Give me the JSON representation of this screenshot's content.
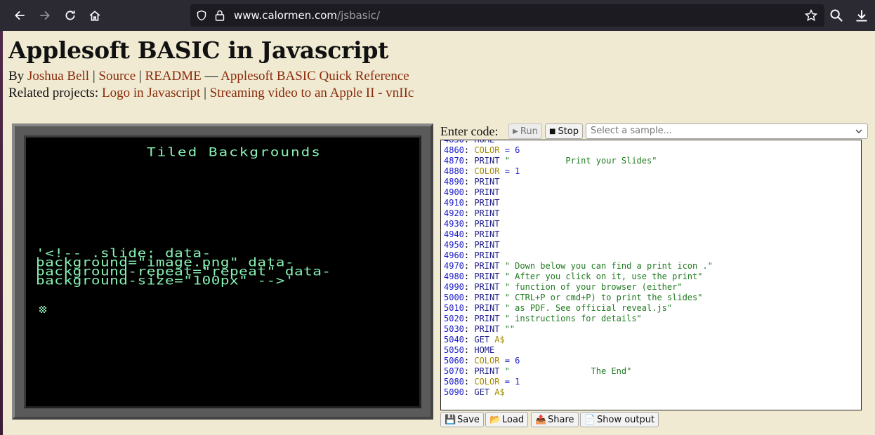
{
  "browser": {
    "url_domain": "www.calormen.com",
    "url_path": "/jsbasic/"
  },
  "page": {
    "title": "Applesoft BASIC in Javascript",
    "byline_prefix": "By",
    "author_link": "Joshua Bell",
    "source_link": "Source",
    "readme_link": "README",
    "dash": "—",
    "quickref_link": "Applesoft BASIC Quick Reference",
    "related_prefix": "Related projects:",
    "logo_link": "Logo in Javascript",
    "streaming_link": "Streaming video to an Apple II - vnIIc"
  },
  "screen": {
    "title_line": "Tiled Backgrounds",
    "body_text": "'<!-- .slide: data-\nbackground=\"image.png\" data-\nbackground-repeat=\"repeat\" data-\nbackground-size=\"100px\" -->'"
  },
  "editor": {
    "label": "Enter code:",
    "run_label": "Run",
    "stop_label": "Stop",
    "sample_placeholder": "Select a sample...",
    "lines": [
      {
        "n": "4860",
        "kw": "COLOR",
        "rest": " = 6",
        "type": "color"
      },
      {
        "n": "4870",
        "kw": "PRINT",
        "rest": " \"           Print your Slides\"",
        "type": "print"
      },
      {
        "n": "4880",
        "kw": "COLOR",
        "rest": " = 1",
        "type": "color"
      },
      {
        "n": "4890",
        "kw": "PRINT",
        "rest": "",
        "type": "print"
      },
      {
        "n": "4900",
        "kw": "PRINT",
        "rest": "",
        "type": "print"
      },
      {
        "n": "4910",
        "kw": "PRINT",
        "rest": "",
        "type": "print"
      },
      {
        "n": "4920",
        "kw": "PRINT",
        "rest": "",
        "type": "print"
      },
      {
        "n": "4930",
        "kw": "PRINT",
        "rest": "",
        "type": "print"
      },
      {
        "n": "4940",
        "kw": "PRINT",
        "rest": "",
        "type": "print"
      },
      {
        "n": "4950",
        "kw": "PRINT",
        "rest": "",
        "type": "print"
      },
      {
        "n": "4960",
        "kw": "PRINT",
        "rest": "",
        "type": "print"
      },
      {
        "n": "4970",
        "kw": "PRINT",
        "rest": " \" Down below you can find a print icon .\"",
        "type": "print"
      },
      {
        "n": "4980",
        "kw": "PRINT",
        "rest": " \" After you click on it, use the print\"",
        "type": "print"
      },
      {
        "n": "4990",
        "kw": "PRINT",
        "rest": " \" function of your browser (either\"",
        "type": "print"
      },
      {
        "n": "5000",
        "kw": "PRINT",
        "rest": " \" CTRL+P or cmd+P) to print the slides\"",
        "type": "print"
      },
      {
        "n": "5010",
        "kw": "PRINT",
        "rest": " \" as PDF. See official reveal.js\"",
        "type": "print"
      },
      {
        "n": "5020",
        "kw": "PRINT",
        "rest": " \" instructions for details\"",
        "type": "print"
      },
      {
        "n": "5030",
        "kw": "PRINT",
        "rest": " \"\"",
        "type": "print"
      },
      {
        "n": "5040",
        "kw": "GET",
        "rest": " A$",
        "type": "get"
      },
      {
        "n": "5050",
        "kw": "HOME",
        "rest": "",
        "type": "home"
      },
      {
        "n": "5060",
        "kw": "COLOR",
        "rest": " = 6",
        "type": "color"
      },
      {
        "n": "5070",
        "kw": "PRINT",
        "rest": " \"                The End\"",
        "type": "print"
      },
      {
        "n": "5080",
        "kw": "COLOR",
        "rest": " = 1",
        "type": "color"
      },
      {
        "n": "5090",
        "kw": "GET",
        "rest": " A$",
        "type": "get"
      }
    ],
    "save_label": "Save",
    "load_label": "Load",
    "share_label": "Share",
    "show_output_label": "Show output"
  }
}
